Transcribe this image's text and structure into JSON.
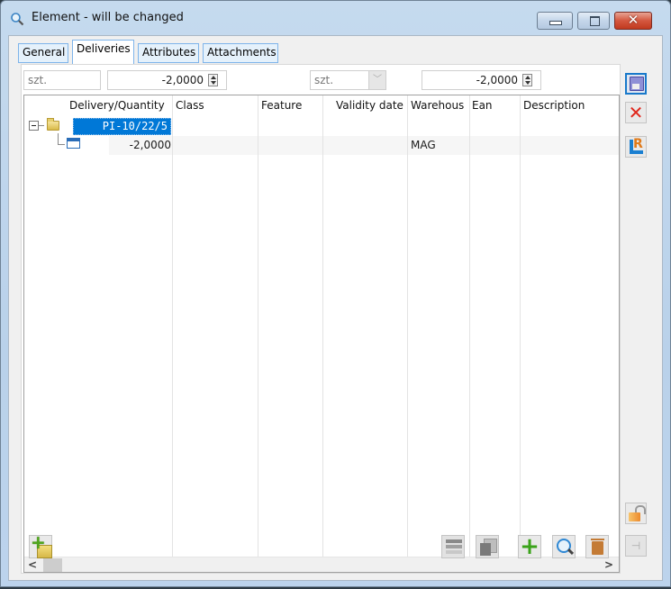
{
  "window": {
    "title": "Element - will be changed",
    "icon": "magnifier-icon",
    "controls": {
      "minimize": "minimize",
      "maximize": "maximize",
      "close": "✕"
    }
  },
  "tabs": [
    {
      "label": "General",
      "active": false
    },
    {
      "label": "Deliveries",
      "active": true
    },
    {
      "label": "Attributes",
      "active": false
    },
    {
      "label": "Attachments",
      "active": false
    }
  ],
  "filters": {
    "unit_left": "szt.",
    "qty_left": "-2,0000",
    "unit_right": "szt.",
    "qty_right": "-2,0000",
    "dropdown_glyph": "﹀"
  },
  "grid": {
    "columns": [
      "Delivery/Quantity",
      "Class",
      "Feature",
      "Validity date",
      "Warehous",
      "Ean",
      "Description"
    ],
    "rows": [
      {
        "level": 0,
        "expanded": true,
        "icon": "folder-icon",
        "delivery": "PI-10/22/5",
        "selected": true,
        "class": "",
        "feature": "",
        "validity_date": "",
        "warehouse": "",
        "ean": "",
        "description": ""
      },
      {
        "level": 1,
        "icon": "document-icon",
        "delivery": "-2,0000",
        "class": "",
        "feature": "",
        "validity_date": "",
        "warehouse": "MAG",
        "ean": "",
        "description": ""
      }
    ],
    "scroll_left": "<",
    "scroll_right": ">"
  },
  "side_toolbar": {
    "save": "save",
    "delete": "✕",
    "report_letter": "R",
    "lock": "lock",
    "pin": "⊣"
  },
  "bottom_toolbar": {
    "add_folder_plus": "+",
    "add": "+"
  }
}
